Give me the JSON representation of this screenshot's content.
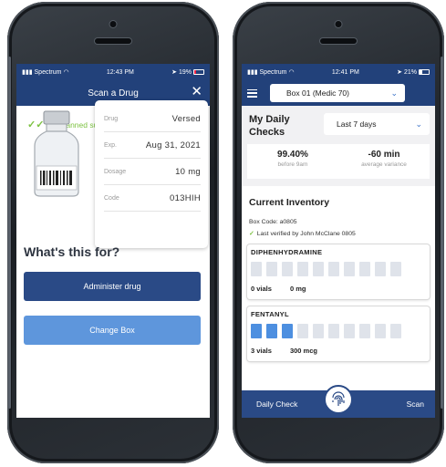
{
  "left": {
    "status": {
      "carrier": "Spectrum",
      "time": "12:43 PM",
      "battery": "19%"
    },
    "header": {
      "title": "Scan a Drug",
      "close": "✕"
    },
    "scan_status": "Scanned successfully",
    "details": [
      {
        "key": "Drug",
        "value": "Versed"
      },
      {
        "key": "Exp.",
        "value": "Aug 31, 2021"
      },
      {
        "key": "Dosage",
        "value": "10 mg"
      },
      {
        "key": "Code",
        "value": "013HIH"
      }
    ],
    "question": "What's this for?",
    "buttons": {
      "administer": "Administer drug",
      "change_box": "Change Box"
    }
  },
  "right": {
    "status": {
      "carrier": "Spectrum",
      "time": "12:41 PM",
      "battery": "21%"
    },
    "box_select": "Box 01 (Medic 70)",
    "daily_checks": "My Daily Checks",
    "period": "Last 7 days",
    "stats": [
      {
        "value": "99.40%",
        "label": "before 9am"
      },
      {
        "value": "-60 min",
        "label": "average variance"
      }
    ],
    "inventory": {
      "title": "Current Inventory",
      "box_code": "Box Code: a0805",
      "verified": "Last verified by John McClane 0805",
      "drugs": [
        {
          "name": "DIPHENHYDRAMINE",
          "vials": "0 vials",
          "amount": "0 mg",
          "filled": 0,
          "slots": 10
        },
        {
          "name": "FENTANYL",
          "vials": "3 vials",
          "amount": "300 mcg",
          "filled": 3,
          "slots": 10
        }
      ]
    },
    "nav": {
      "daily_check": "Daily Check",
      "scan": "Scan"
    }
  },
  "colors": {
    "navy": "#22417a",
    "button_dark": "#2a4a86",
    "button_light": "#5e96dc",
    "success_green": "#7dc242",
    "slot_filled": "#4d8fe0"
  }
}
